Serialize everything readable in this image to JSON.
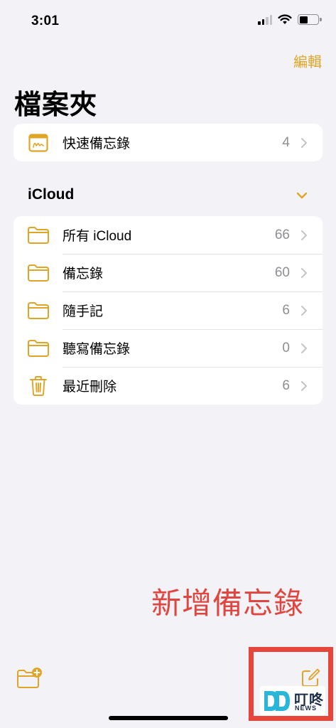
{
  "status_bar": {
    "time": "3:01"
  },
  "header": {
    "edit_label": "編輯",
    "title": "檔案夾"
  },
  "quick_notes": {
    "label": "快速備忘錄",
    "count": "4",
    "icon": "quick-note-icon"
  },
  "icloud_section": {
    "title": "iCloud",
    "folders": [
      {
        "label": "所有 iCloud",
        "count": "66",
        "icon": "folder-icon"
      },
      {
        "label": "備忘錄",
        "count": "60",
        "icon": "folder-icon"
      },
      {
        "label": "隨手記",
        "count": "6",
        "icon": "folder-icon"
      },
      {
        "label": "聽寫備忘錄",
        "count": "0",
        "icon": "folder-icon"
      },
      {
        "label": "最近刪除",
        "count": "6",
        "icon": "trash-icon"
      }
    ]
  },
  "annotation": {
    "text": "新增備忘錄"
  },
  "watermark": {
    "text": "叮咚",
    "subtext": "NEWS"
  },
  "colors": {
    "accent": "#e0a526",
    "annotation": "#e0453f",
    "background": "#f2f2f7"
  }
}
